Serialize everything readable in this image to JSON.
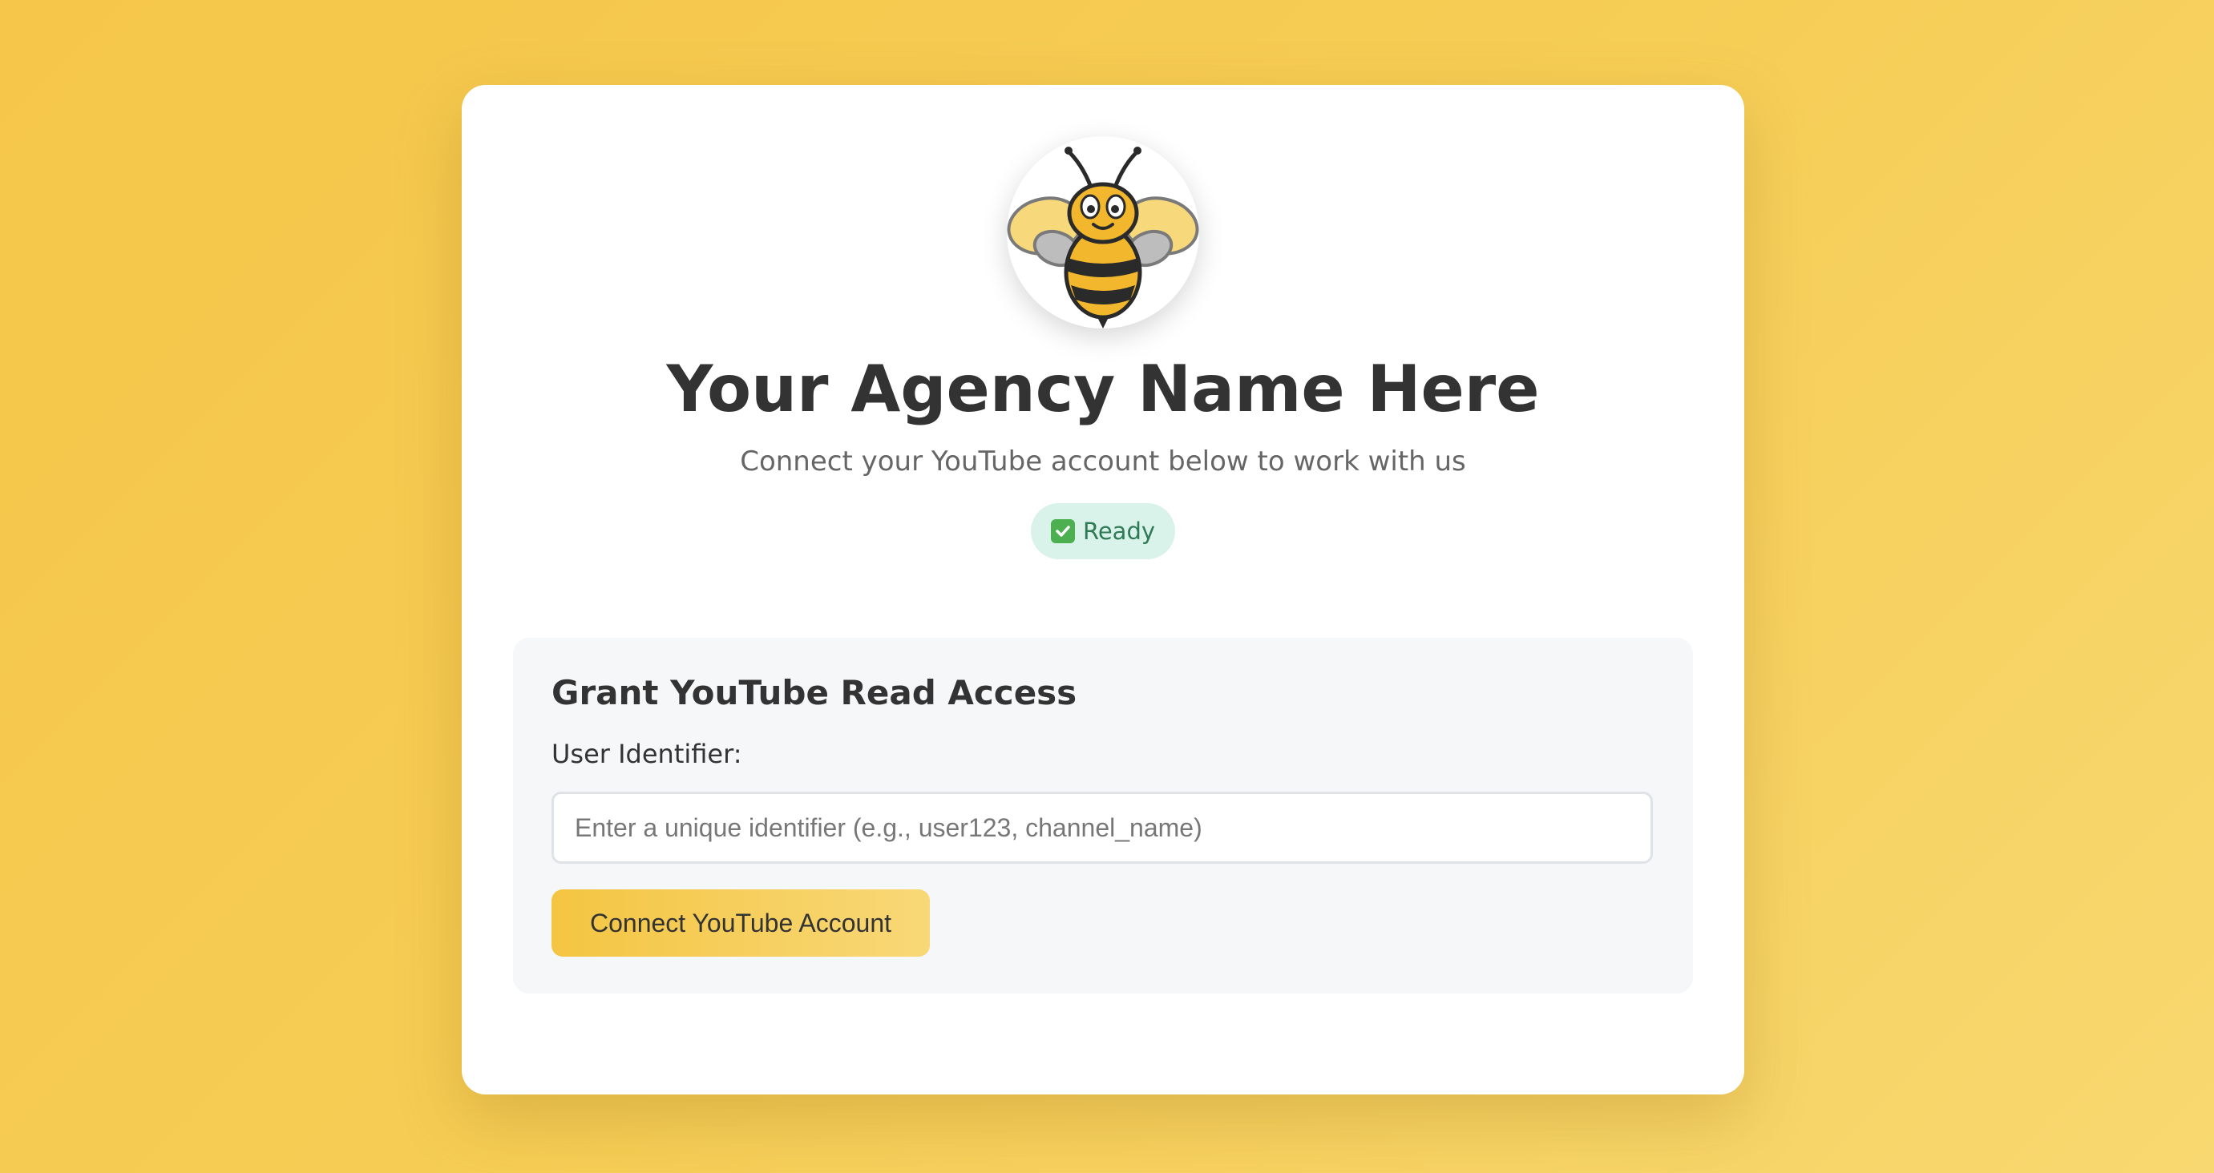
{
  "brand": {
    "logo_icon": "bee-mascot-icon",
    "title": "Your Agency Name Here",
    "subtitle": "Connect your YouTube account below to work with us"
  },
  "status": {
    "icon": "check-box-icon",
    "label": "Ready",
    "color": "#2f7a55",
    "background": "#d9f2ea"
  },
  "access_form": {
    "heading": "Grant YouTube Read Access",
    "field_label": "User Identifier:",
    "input_value": "",
    "input_placeholder": "Enter a unique identifier (e.g., user123, channel_name)",
    "submit_label": "Connect YouTube Account"
  },
  "colors": {
    "background": "#f5c649",
    "accent": "#f4c542",
    "card": "#ffffff",
    "panel": "#f6f7f9"
  }
}
